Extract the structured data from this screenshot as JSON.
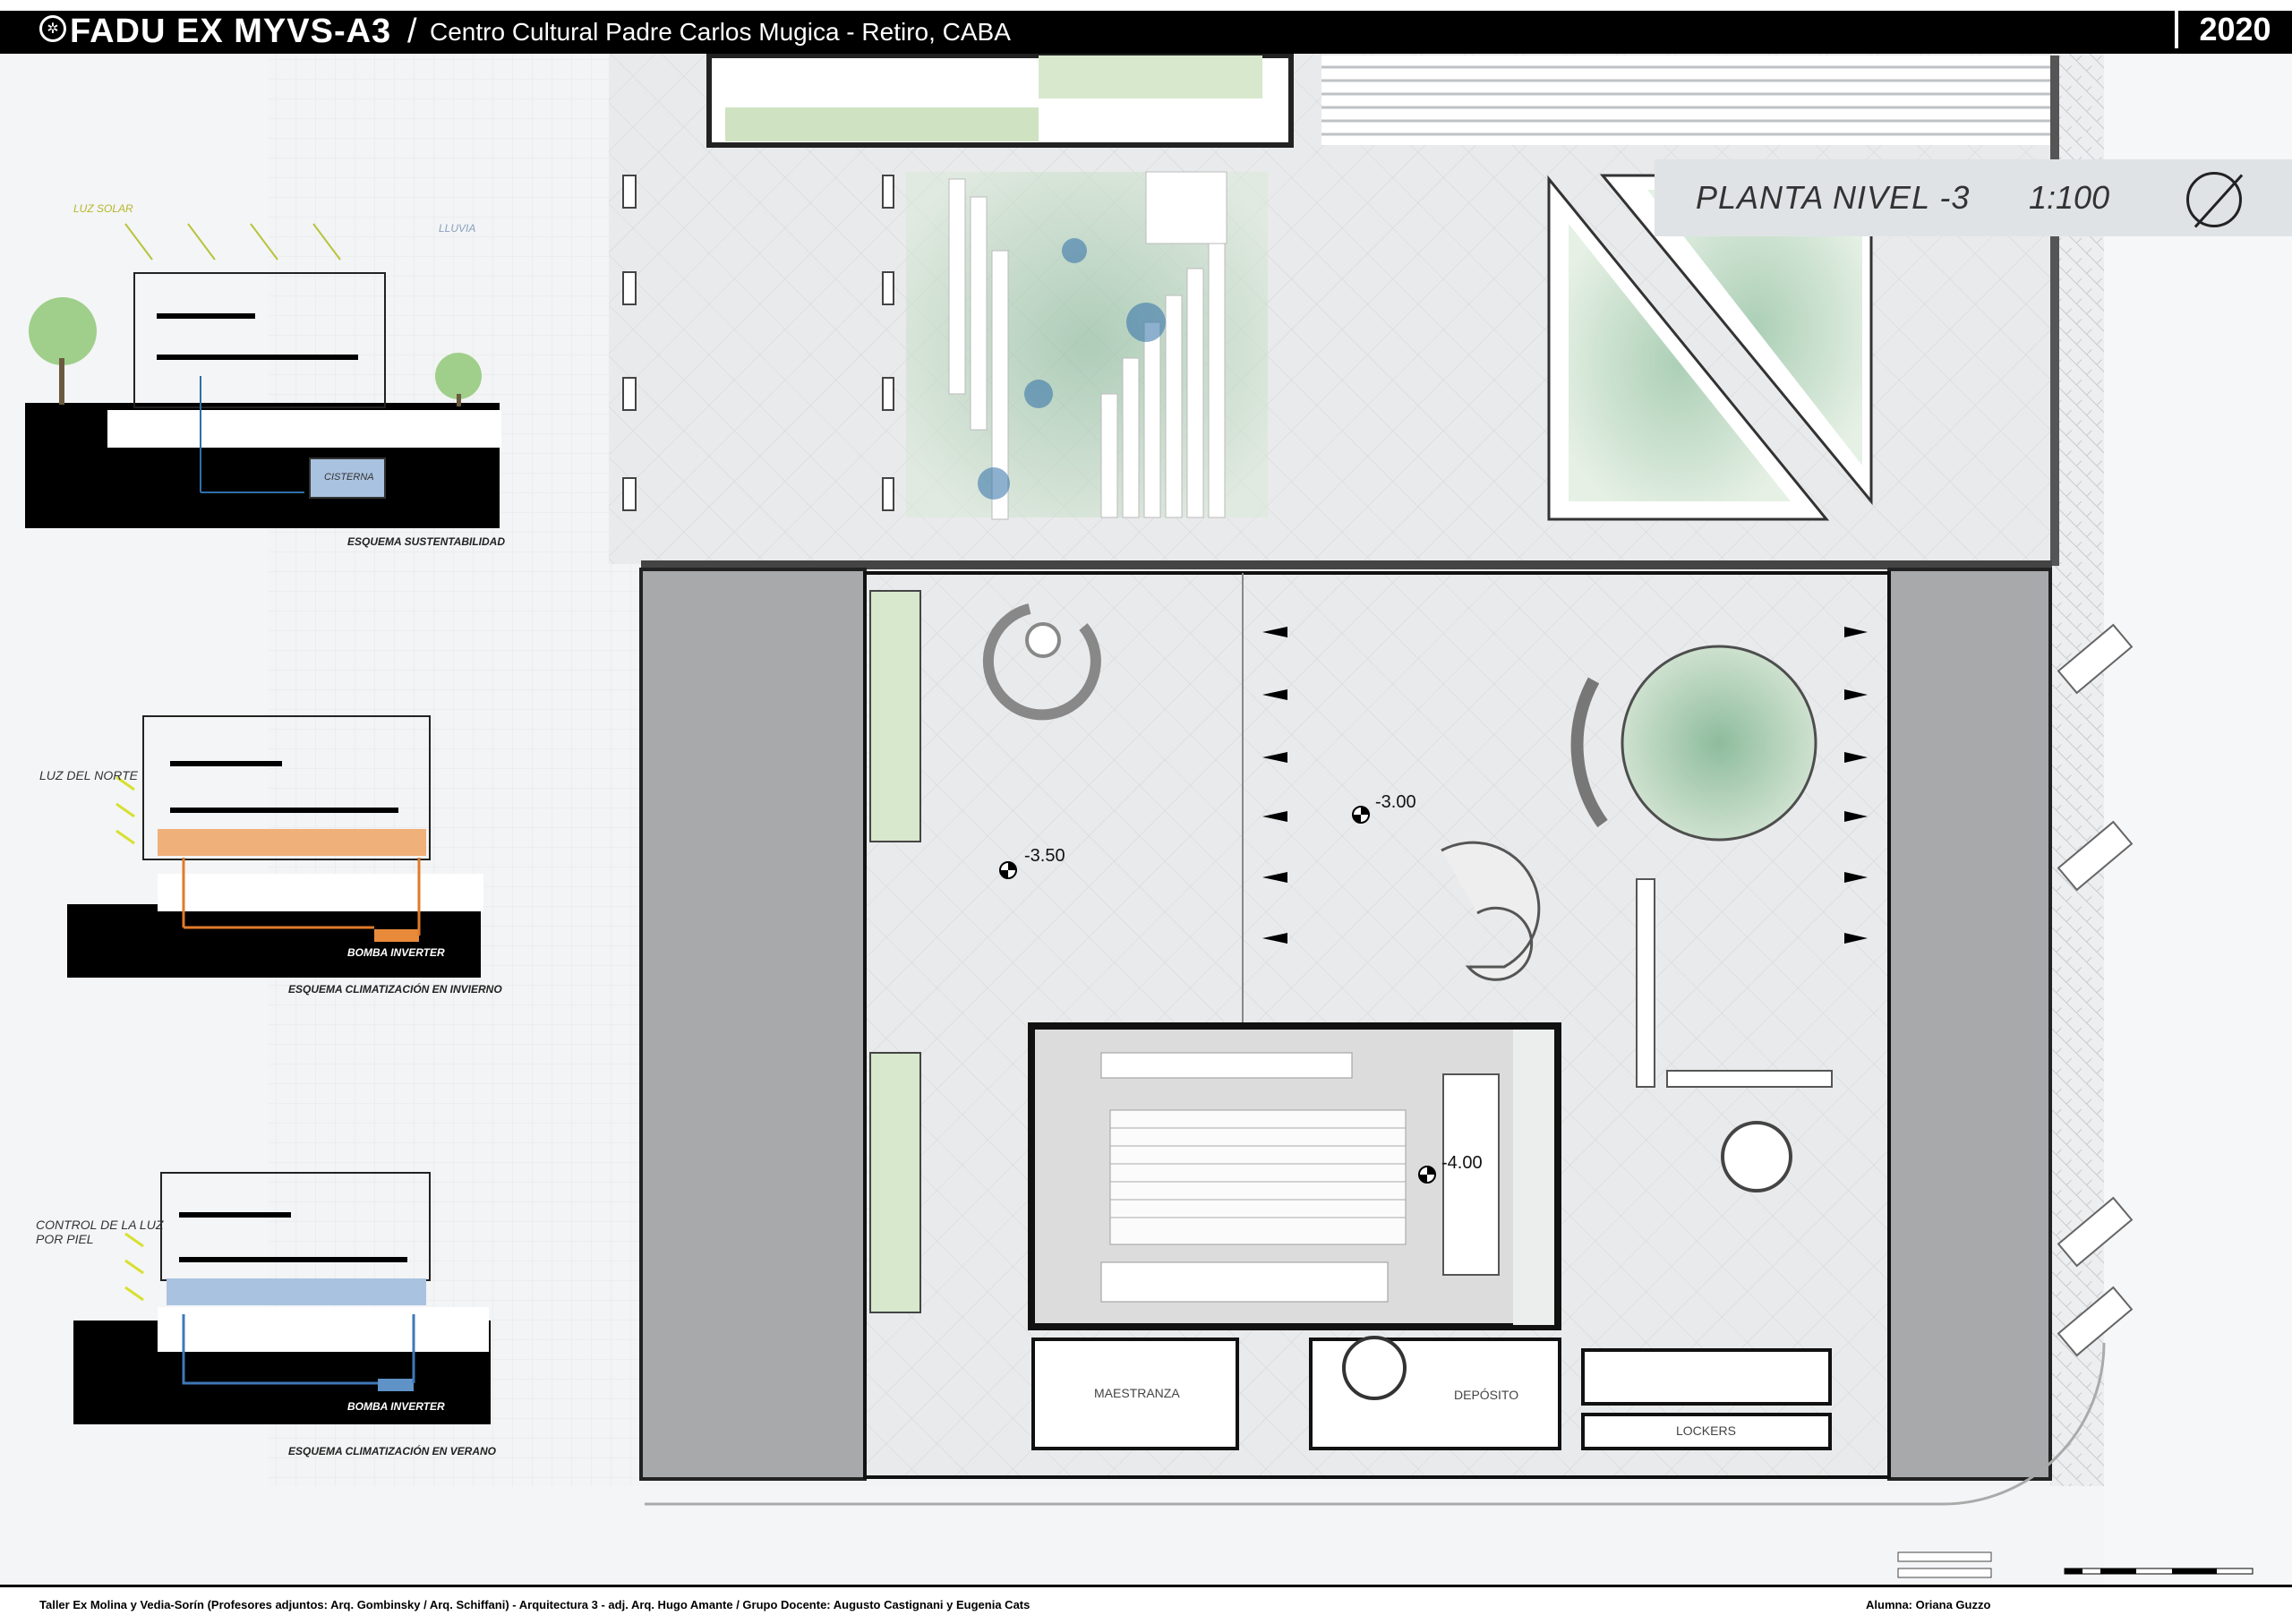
{
  "header": {
    "logo_icon": "fadu-seal-icon",
    "title": "FADU EX MYVS-A3",
    "separator": "/",
    "subtitle": "Centro Cultural Padre Carlos Mugica  - Retiro, CABA",
    "year": "2020"
  },
  "plan": {
    "title": "PLANTA NIVEL -3",
    "scale": "1:100",
    "north_icon": "north-arrow-icon",
    "levels": [
      "-3.50",
      "-3.00",
      "-4.00"
    ],
    "rooms": {
      "maestranza": "MAESTRANZA",
      "deposito": "DEPÓSITO",
      "lockers": "LOCKERS"
    }
  },
  "schemes": {
    "sustentabilidad": {
      "caption": "ESQUEMA SUSTENTABILIDAD",
      "luz_solar": "LUZ SOLAR",
      "lluvia": "LLUVIA",
      "cisterna": "CISTERNA"
    },
    "invierno": {
      "caption": "ESQUEMA CLIMATIZACIÓN EN INVIERNO",
      "luz": "LUZ DEL NORTE",
      "bomba": "BOMBA INVERTER"
    },
    "verano": {
      "caption": "ESQUEMA CLIMATIZACIÓN EN VERANO",
      "luz_1": "CONTROL DE LA LUZ",
      "luz_2": "POR PIEL",
      "bomba": "BOMBA INVERTER"
    }
  },
  "colors": {
    "green": "#9fcf8a",
    "orange": "#f0b07a",
    "blue": "#a9c2e0",
    "gray_block": "#a8a9ab"
  },
  "footer": {
    "credits": "Taller Ex Molina y Vedia-Sorín (Profesores adjuntos:  Arq. Gombinsky / Arq. Schiffani) - Arquitectura 3 - adj. Arq. Hugo Amante / Grupo Docente:  Augusto Castignani y Eugenia Cats",
    "student": "Alumna:    Oriana Guzzo"
  }
}
